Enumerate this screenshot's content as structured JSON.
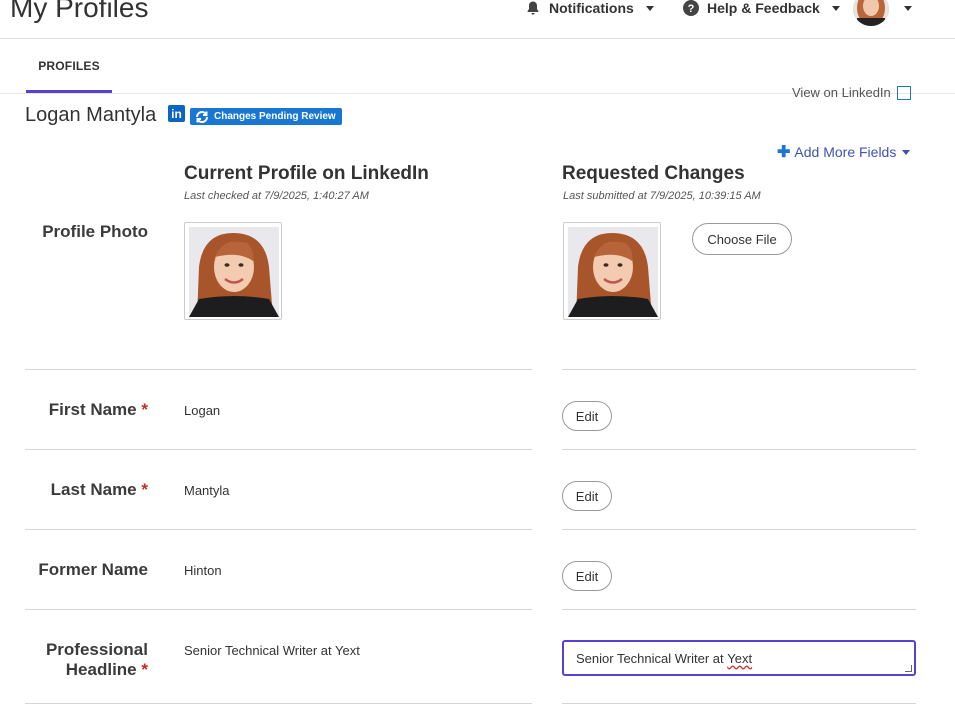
{
  "header": {
    "title": "My Profiles",
    "notifications_label": "Notifications",
    "help_label": "Help & Feedback"
  },
  "tabs": [
    {
      "label": "PROFILES",
      "active": true
    }
  ],
  "profile": {
    "name": "Logan Mantyla",
    "linkedin_badge": "in",
    "status_badge": "Changes Pending Review",
    "view_link": "View on LinkedIn",
    "add_more_fields": "Add More Fields"
  },
  "columns": {
    "current": {
      "title": "Current Profile on LinkedIn",
      "subtitle": "Last checked at 7/9/2025, 1:40:27 AM"
    },
    "requested": {
      "title": "Requested Changes",
      "subtitle": "Last submitted at 7/9/2025, 10:39:15 AM"
    }
  },
  "fields": {
    "photo": {
      "label": "Profile Photo",
      "button": "Choose File"
    },
    "first_name": {
      "label": "First Name",
      "required": "*",
      "value": "Logan",
      "button": "Edit"
    },
    "last_name": {
      "label": "Last Name",
      "required": "*",
      "value": "Mantyla",
      "button": "Edit"
    },
    "former_name": {
      "label": "Former Name",
      "value": "Hinton",
      "button": "Edit"
    },
    "headline": {
      "label_line1": "Professional",
      "label_line2": "Headline",
      "required": "*",
      "value": "Senior Technical Writer at Yext",
      "input_prefix": "Senior Technical Writer at ",
      "input_flagged": "Yext"
    }
  },
  "colors": {
    "accent": "#5a3fd6",
    "link": "#3f51b5",
    "badge": "#1976d2",
    "linkedin": "#0a66c2",
    "required": "#c62828"
  }
}
